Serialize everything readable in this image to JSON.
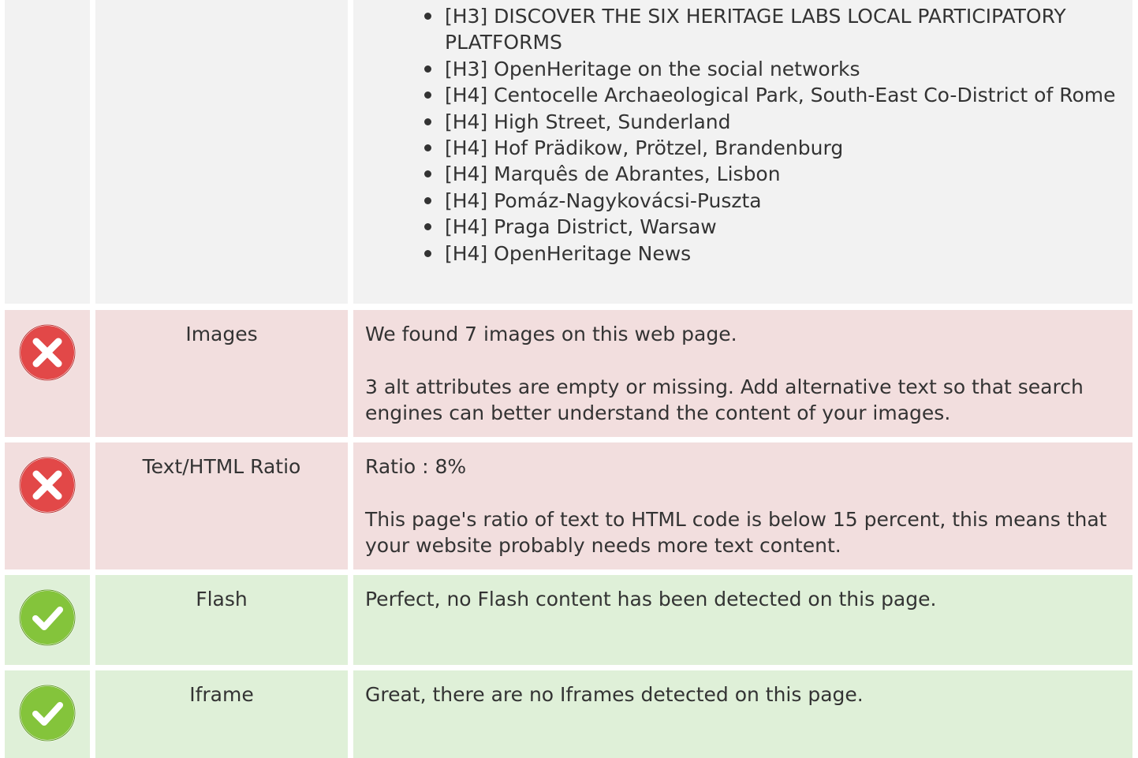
{
  "headings_row": {
    "items": [
      "[H3] DISCOVER THE SIX HERITAGE LABS LOCAL PARTICIPATORY PLATFORMS",
      "[H3] OpenHeritage on the social networks",
      "[H4] Centocelle Archaeological Park, South-East Co-District of Rome",
      "[H4] High Street, Sunderland",
      "[H4] Hof Prädikow, Prötzel, Brandenburg",
      "[H4] Marquês de Abrantes, Lisbon",
      "[H4] Pomáz-Nagykovácsi-Puszta",
      "[H4] Praga District, Warsaw",
      "[H4] OpenHeritage News"
    ]
  },
  "checks": [
    {
      "status": "error",
      "icon": "error-x-icon",
      "title": "Images",
      "paragraphs": [
        "We found 7 images on this web page.",
        "3 alt attributes are empty or missing. Add alternative text so that search engines can better understand the content of your images."
      ]
    },
    {
      "status": "error",
      "icon": "error-x-icon",
      "title": "Text/HTML Ratio",
      "paragraphs": [
        "Ratio : 8%",
        "This page's ratio of text to HTML code is below 15 percent, this means that your website probably needs more text content."
      ]
    },
    {
      "status": "success",
      "icon": "success-check-icon",
      "title": "Flash",
      "paragraphs": [
        "Perfect, no Flash content has been detected on this page."
      ]
    },
    {
      "status": "success",
      "icon": "success-check-icon",
      "title": "Iframe",
      "paragraphs": [
        "Great, there are no Iframes detected on this page."
      ]
    }
  ],
  "colors": {
    "neutral_bg": "#f2f2f2",
    "error_bg": "#f2dede",
    "success_bg": "#dff0d8",
    "error_icon": "#e24848",
    "success_icon": "#84c43b",
    "text": "#333333"
  }
}
